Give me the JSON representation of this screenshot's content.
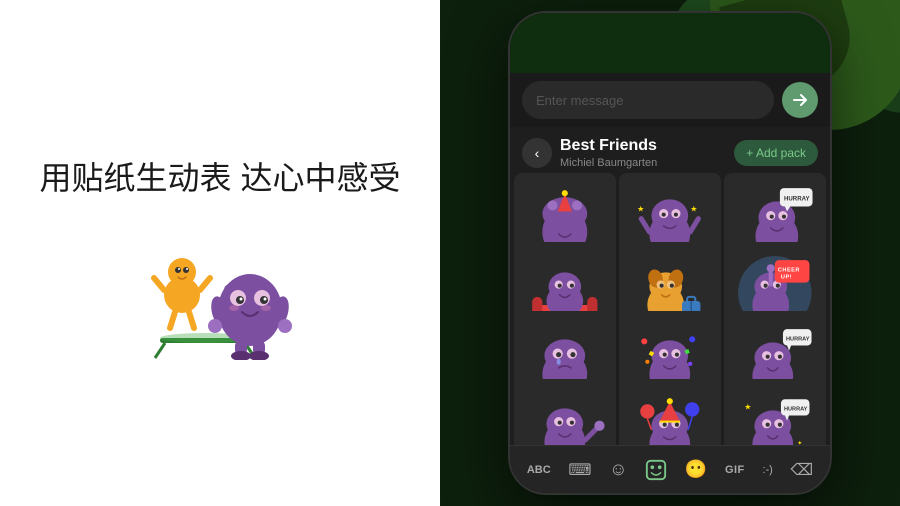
{
  "left": {
    "chinese_text": "用贴纸生动表\n达心中感受"
  },
  "right": {
    "phone": {
      "message_input_placeholder": "Enter message",
      "sticker_pack": {
        "title": "Best Friends",
        "author": "Michiel Baumgarten",
        "add_button": "+ Add pack"
      },
      "toolbar": {
        "items": [
          {
            "label": "ABC",
            "name": "keyboard"
          },
          {
            "label": "⌨",
            "name": "stickers-recent"
          },
          {
            "label": "☺",
            "name": "emoji"
          },
          {
            "label": "🔲",
            "name": "stickers-active"
          },
          {
            "label": "😶",
            "name": "emoji-face"
          },
          {
            "label": "GIF",
            "name": "gif"
          },
          {
            "label": ":-)",
            "name": "emoticon"
          },
          {
            "label": "⌫",
            "name": "backspace"
          }
        ]
      },
      "stickers": {
        "rows": [
          [
            {
              "id": "s1",
              "color": "#7c4fa0",
              "cheer": false
            },
            {
              "id": "s2",
              "color": "#7c4fa0",
              "cheer": false
            },
            {
              "id": "s3",
              "color": "#7c4fa0",
              "cheer": false
            }
          ],
          [
            {
              "id": "s4",
              "color": "#7c4fa0",
              "cheer": false
            },
            {
              "id": "s5",
              "color": "#e8a030",
              "cheer": false
            },
            {
              "id": "s6",
              "color": "#7c4fa0",
              "cheer": true,
              "text": "CHEER UP!"
            }
          ],
          [
            {
              "id": "s7",
              "color": "#7c4fa0",
              "cheer": false
            },
            {
              "id": "s8",
              "color": "#7c4fa0",
              "cheer": false
            },
            {
              "id": "s9",
              "color": "#7c4fa0",
              "cheer": false,
              "hurray": true
            }
          ],
          [
            {
              "id": "s10",
              "color": "#7c4fa0",
              "cheer": false
            },
            {
              "id": "s11",
              "color": "#7c4fa0",
              "cheer": false
            },
            {
              "id": "s12",
              "color": "#7c4fa0",
              "hurray": true
            }
          ]
        ]
      }
    }
  }
}
